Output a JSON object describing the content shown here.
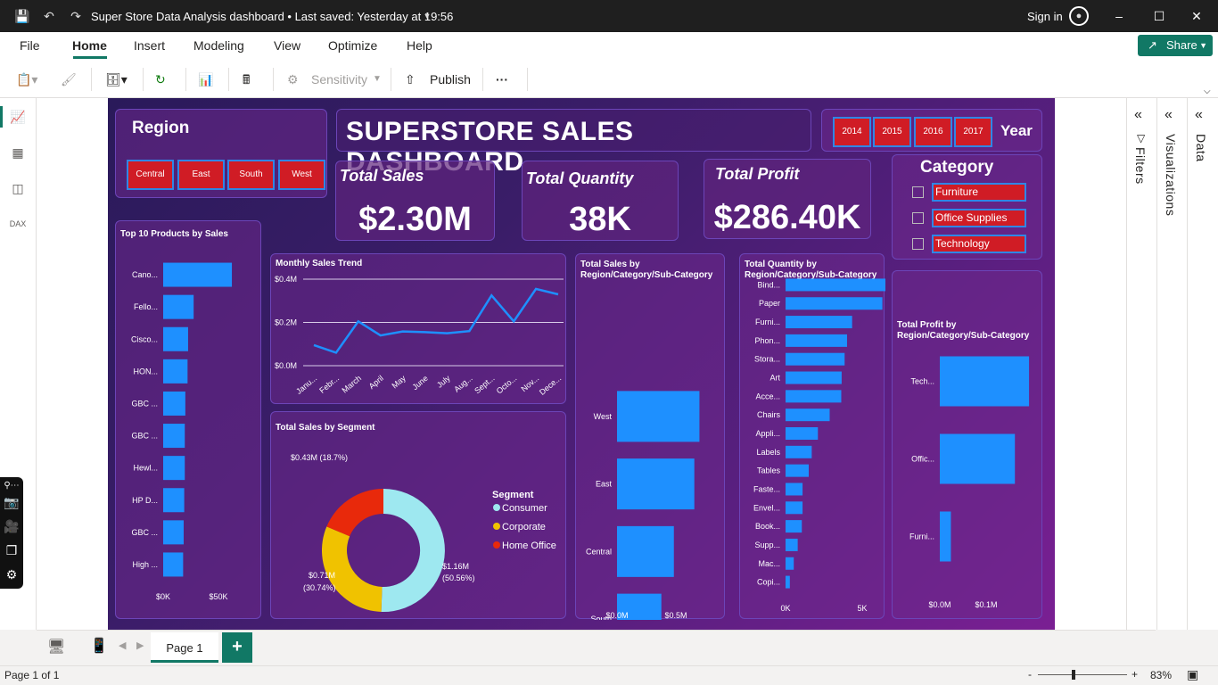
{
  "titlebar": {
    "title": "Super Store Data Analysis dashboard • Last saved: Yesterday at 19:56",
    "sign_in": "Sign in"
  },
  "menu": {
    "items": [
      "File",
      "Home",
      "Insert",
      "Modeling",
      "View",
      "Optimize",
      "Help"
    ],
    "active": "Home",
    "share": "Share"
  },
  "toolbar": {
    "sensitivity": "Sensitivity",
    "publish": "Publish",
    "more": "···"
  },
  "panes": {
    "filters": "Filters",
    "visualizations": "Visualizations",
    "data": "Data"
  },
  "pagebar": {
    "page_tab": "Page 1",
    "add": "+"
  },
  "status": {
    "page_info": "Page 1 of 1",
    "zoom": "83%",
    "zoom_minus": "-",
    "zoom_plus": "+"
  },
  "dashboard": {
    "title": "SUPERSTORE SALES DASHBOARD",
    "region_slicer": {
      "title": "Region",
      "options": [
        "Central",
        "East",
        "South",
        "West"
      ]
    },
    "year_slicer": {
      "title": "Year",
      "options": [
        "2014",
        "2015",
        "2016",
        "2017"
      ]
    },
    "kpis": [
      {
        "label": "Total Sales",
        "value": "$2.30M"
      },
      {
        "label": "Total Quantity",
        "value": "38K"
      },
      {
        "label": "Total Profit",
        "value": "$286.40K"
      }
    ],
    "category_slicer": {
      "title": "Category",
      "options": [
        "Furniture",
        "Office Supplies",
        "Technology"
      ]
    },
    "colors": {
      "bar": "#1e90ff",
      "slicer_fill": "#d01c25",
      "slicer_border": "#2f86e6",
      "card_border": "#6c45b8"
    }
  },
  "chart_data": [
    {
      "type": "bar",
      "orientation": "horizontal",
      "title": "Top 10 Products by Sales",
      "categories": [
        "Cano...",
        "Fello...",
        "Cisco...",
        "HON...",
        "GBC ...",
        "GBC ...",
        "Hewl...",
        "HP D...",
        "GBC ...",
        "High ..."
      ],
      "values": [
        62000,
        27500,
        22500,
        22000,
        20000,
        19500,
        19500,
        19000,
        18500,
        18000
      ],
      "x_ticks": [
        "$0K",
        "$50K"
      ],
      "xlim": [
        0,
        70000
      ]
    },
    {
      "type": "line",
      "title": "Monthly Sales Trend",
      "x": [
        "Janu...",
        "Febr...",
        "March",
        "April",
        "May",
        "June",
        "July",
        "Aug...",
        "Sept...",
        "Octo...",
        "Nov...",
        "Dece..."
      ],
      "values": [
        95000,
        60000,
        205000,
        140000,
        158000,
        155000,
        150000,
        160000,
        325000,
        205000,
        355000,
        330000
      ],
      "y_ticks": [
        "$0.0M",
        "$0.2M",
        "$0.4M"
      ],
      "ylim": [
        0,
        400000
      ]
    },
    {
      "type": "pie",
      "title": "Total Sales by Segment",
      "legend_title": "Segment",
      "slices": [
        {
          "name": "Consumer",
          "value": 1.16,
          "label": "$1.16M",
          "pct_label": "(50.56%)",
          "percent": 50.56,
          "color": "#9ee8f0"
        },
        {
          "name": "Corporate",
          "value": 0.71,
          "label": "$0.71M",
          "pct_label": "(30.74%)",
          "percent": 30.74,
          "color": "#f0c200"
        },
        {
          "name": "Home Office",
          "value": 0.43,
          "label": "$0.43M (18.7%)",
          "pct_label": "",
          "percent": 18.7,
          "color": "#e8290b"
        }
      ]
    },
    {
      "type": "bar",
      "title": "Total Sales by Region/Category/Sub-Category",
      "categories": [
        "West",
        "East",
        "Central",
        "South"
      ],
      "values": [
        0.725,
        0.68,
        0.5,
        0.39
      ],
      "x_ticks": [
        "$0.0M",
        "$0.5M"
      ],
      "xlim": [
        0,
        0.8
      ]
    },
    {
      "type": "bar",
      "title": "Total Quantity by Region/Category/Sub-Category",
      "categories": [
        "Bind...",
        "Paper",
        "Furni...",
        "Phon...",
        "Stora...",
        "Art",
        "Acce...",
        "Chairs",
        "Appli...",
        "Labels",
        "Tables",
        "Faste...",
        "Envel...",
        "Book...",
        "Supp...",
        "Mac...",
        "Copi..."
      ],
      "values": [
        5970,
        5180,
        3560,
        3290,
        3160,
        3000,
        2980,
        2360,
        1730,
        1400,
        1240,
        910,
        910,
        870,
        650,
        440,
        230
      ],
      "x_ticks": [
        "0K",
        "5K"
      ],
      "xlim": [
        0,
        6200
      ]
    },
    {
      "type": "bar",
      "title": "Total Profit by Region/Category/Sub-Category",
      "categories": [
        "Tech...",
        "Offic...",
        "Furni..."
      ],
      "values": [
        0.145,
        0.122,
        0.018
      ],
      "x_ticks": [
        "$0.0M",
        "$0.1M"
      ],
      "xlim": [
        0,
        0.155
      ]
    }
  ]
}
